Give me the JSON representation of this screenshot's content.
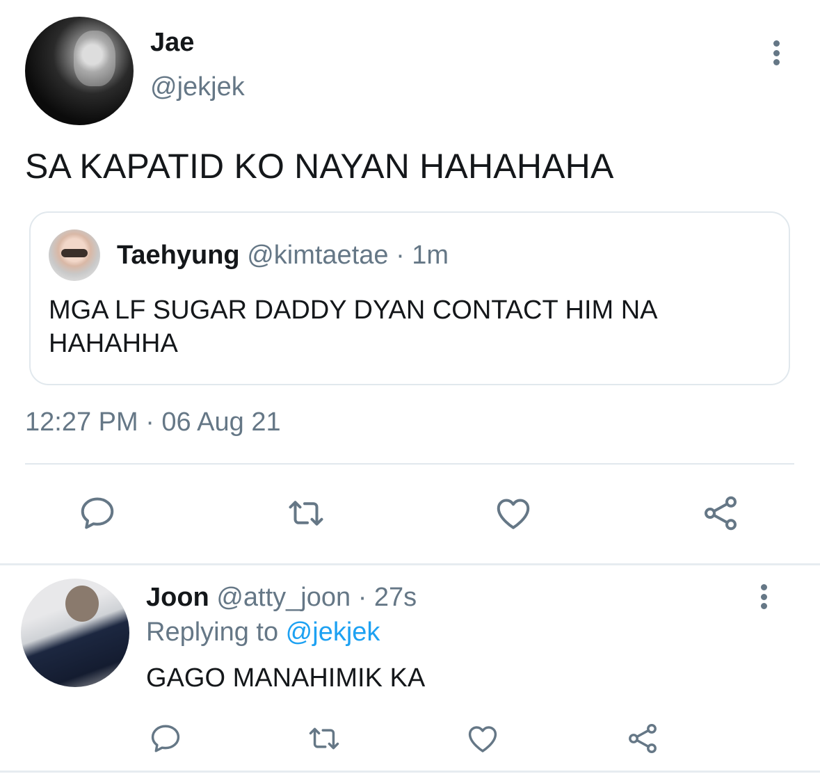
{
  "main_tweet": {
    "author_name": "Jae",
    "author_handle": "@jekjek",
    "text": "SA KAPATID KO NAYAN HAHAHAHA",
    "timestamp": "12:27 PM · 06 Aug 21",
    "quoted": {
      "author_name": "Taehyung",
      "author_meta": " @kimtaetae · 1m",
      "text": "MGA LF SUGAR DADDY DYAN CONTACT HIM NA HAHAHHA"
    },
    "actions": [
      "reply-icon",
      "retweet-icon",
      "like-icon",
      "share-icon"
    ]
  },
  "reply": {
    "author_name": "Joon",
    "author_meta": " @atty_joon · 27s",
    "replying_prefix": "Replying to ",
    "replying_handle": "@jekjek",
    "text": "GAGO MANAHIMIK KA",
    "actions": [
      "reply-icon",
      "retweet-icon",
      "like-icon",
      "share-icon"
    ]
  },
  "colors": {
    "text_primary": "#14171a",
    "text_secondary": "#657786",
    "link": "#1da1f2",
    "border": "#e1e8ed"
  }
}
